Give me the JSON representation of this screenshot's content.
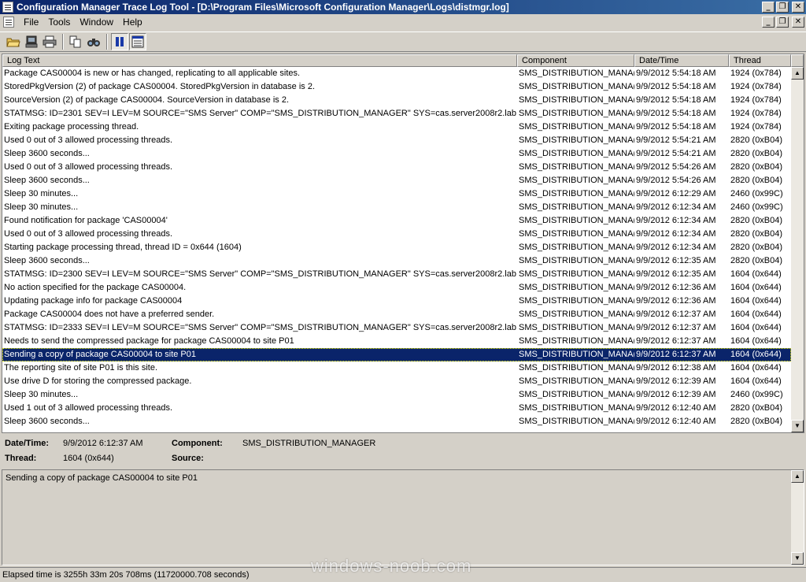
{
  "window": {
    "title": "Configuration Manager Trace Log Tool - [D:\\Program Files\\Microsoft Configuration Manager\\Logs\\distmgr.log]",
    "controls": {
      "minimize": "_",
      "restore": "❐",
      "close": "✕"
    }
  },
  "menu": {
    "items": [
      "File",
      "Tools",
      "Window",
      "Help"
    ]
  },
  "toolbar": {
    "buttons": [
      "open-folder-icon",
      "computer-icon",
      "print-icon",
      "copy-icon",
      "find-icon",
      "pause-icon",
      "details-pane-icon"
    ]
  },
  "log": {
    "columns": [
      "Log Text",
      "Component",
      "Date/Time",
      "Thread"
    ],
    "rows": [
      {
        "text": "Package CAS00004 is new or has changed, replicating to all applicable sites.",
        "component": "SMS_DISTRIBUTION_MANA(",
        "datetime": "9/9/2012 5:54:18 AM",
        "thread": "1924 (0x784)"
      },
      {
        "text": "StoredPkgVersion (2) of package CAS00004. StoredPkgVersion in database is 2.",
        "component": "SMS_DISTRIBUTION_MANA(",
        "datetime": "9/9/2012 5:54:18 AM",
        "thread": "1924 (0x784)"
      },
      {
        "text": "SourceVersion (2) of package CAS00004. SourceVersion in database is 2.",
        "component": "SMS_DISTRIBUTION_MANA(",
        "datetime": "9/9/2012 5:54:18 AM",
        "thread": "1924 (0x784)"
      },
      {
        "text": "STATMSG: ID=2301 SEV=I LEV=M SOURCE=\"SMS Server\" COMP=\"SMS_DISTRIBUTION_MANAGER\" SYS=cas.server2008r2.lab....",
        "component": "SMS_DISTRIBUTION_MANA(",
        "datetime": "9/9/2012 5:54:18 AM",
        "thread": "1924 (0x784)"
      },
      {
        "text": "Exiting package processing thread.",
        "component": "SMS_DISTRIBUTION_MANA(",
        "datetime": "9/9/2012 5:54:18 AM",
        "thread": "1924 (0x784)"
      },
      {
        "text": "Used 0 out of 3 allowed processing threads.",
        "component": "SMS_DISTRIBUTION_MANA(",
        "datetime": "9/9/2012 5:54:21 AM",
        "thread": "2820 (0xB04)"
      },
      {
        "text": "Sleep 3600 seconds...",
        "component": "SMS_DISTRIBUTION_MANA(",
        "datetime": "9/9/2012 5:54:21 AM",
        "thread": "2820 (0xB04)"
      },
      {
        "text": "Used 0 out of 3 allowed processing threads.",
        "component": "SMS_DISTRIBUTION_MANA(",
        "datetime": "9/9/2012 5:54:26 AM",
        "thread": "2820 (0xB04)"
      },
      {
        "text": "Sleep 3600 seconds...",
        "component": "SMS_DISTRIBUTION_MANA(",
        "datetime": "9/9/2012 5:54:26 AM",
        "thread": "2820 (0xB04)"
      },
      {
        "text": "Sleep 30 minutes...",
        "component": "SMS_DISTRIBUTION_MANA(",
        "datetime": "9/9/2012 6:12:29 AM",
        "thread": "2460 (0x99C)"
      },
      {
        "text": "Sleep 30 minutes...",
        "component": "SMS_DISTRIBUTION_MANA(",
        "datetime": "9/9/2012 6:12:34 AM",
        "thread": "2460 (0x99C)"
      },
      {
        "text": "Found notification for package 'CAS00004'",
        "component": "SMS_DISTRIBUTION_MANA(",
        "datetime": "9/9/2012 6:12:34 AM",
        "thread": "2820 (0xB04)"
      },
      {
        "text": "Used 0 out of 3 allowed processing threads.",
        "component": "SMS_DISTRIBUTION_MANA(",
        "datetime": "9/9/2012 6:12:34 AM",
        "thread": "2820 (0xB04)"
      },
      {
        "text": "Starting package processing thread, thread ID = 0x644 (1604)",
        "component": "SMS_DISTRIBUTION_MANA(",
        "datetime": "9/9/2012 6:12:34 AM",
        "thread": "2820 (0xB04)"
      },
      {
        "text": "Sleep 3600 seconds...",
        "component": "SMS_DISTRIBUTION_MANA(",
        "datetime": "9/9/2012 6:12:35 AM",
        "thread": "2820 (0xB04)"
      },
      {
        "text": "STATMSG: ID=2300 SEV=I LEV=M SOURCE=\"SMS Server\" COMP=\"SMS_DISTRIBUTION_MANAGER\" SYS=cas.server2008r2.lab....",
        "component": "SMS_DISTRIBUTION_MANA(",
        "datetime": "9/9/2012 6:12:35 AM",
        "thread": "1604 (0x644)"
      },
      {
        "text": "No action specified for the package CAS00004.",
        "component": "SMS_DISTRIBUTION_MANA(",
        "datetime": "9/9/2012 6:12:36 AM",
        "thread": "1604 (0x644)"
      },
      {
        "text": "Updating package info for package CAS00004",
        "component": "SMS_DISTRIBUTION_MANA(",
        "datetime": "9/9/2012 6:12:36 AM",
        "thread": "1604 (0x644)"
      },
      {
        "text": "Package CAS00004 does not have a preferred sender.",
        "component": "SMS_DISTRIBUTION_MANA(",
        "datetime": "9/9/2012 6:12:37 AM",
        "thread": "1604 (0x644)"
      },
      {
        "text": "STATMSG: ID=2333 SEV=I LEV=M SOURCE=\"SMS Server\" COMP=\"SMS_DISTRIBUTION_MANAGER\" SYS=cas.server2008r2.lab....",
        "component": "SMS_DISTRIBUTION_MANA(",
        "datetime": "9/9/2012 6:12:37 AM",
        "thread": "1604 (0x644)"
      },
      {
        "text": "Needs to send the compressed package for package CAS00004 to site P01",
        "component": "SMS_DISTRIBUTION_MANA(",
        "datetime": "9/9/2012 6:12:37 AM",
        "thread": "1604 (0x644)"
      },
      {
        "text": "Sending a copy of package CAS00004 to site P01",
        "component": "SMS_DISTRIBUTION_MANA(",
        "datetime": "9/9/2012 6:12:37 AM",
        "thread": "1604 (0x644)",
        "selected": true
      },
      {
        "text": "The reporting site of site P01 is this site.",
        "component": "SMS_DISTRIBUTION_MANA(",
        "datetime": "9/9/2012 6:12:38 AM",
        "thread": "1604 (0x644)"
      },
      {
        "text": "Use drive D for storing the compressed package.",
        "component": "SMS_DISTRIBUTION_MANA(",
        "datetime": "9/9/2012 6:12:39 AM",
        "thread": "1604 (0x644)"
      },
      {
        "text": "Sleep 30 minutes...",
        "component": "SMS_DISTRIBUTION_MANA(",
        "datetime": "9/9/2012 6:12:39 AM",
        "thread": "2460 (0x99C)"
      },
      {
        "text": "Used 1 out of 3 allowed processing threads.",
        "component": "SMS_DISTRIBUTION_MANA(",
        "datetime": "9/9/2012 6:12:40 AM",
        "thread": "2820 (0xB04)"
      },
      {
        "text": "Sleep 3600 seconds...",
        "component": "SMS_DISTRIBUTION_MANA(",
        "datetime": "9/9/2012 6:12:40 AM",
        "thread": "2820 (0xB04)"
      }
    ]
  },
  "details": {
    "datetime_label": "Date/Time:",
    "datetime_value": "9/9/2012 6:12:37 AM",
    "component_label": "Component:",
    "component_value": "SMS_DISTRIBUTION_MANAGER",
    "thread_label": "Thread:",
    "thread_value": "1604 (0x644)",
    "source_label": "Source:",
    "source_value": ""
  },
  "message": "Sending a copy of package CAS00004 to site P01",
  "status": "Elapsed time is 3255h 33m 20s 708ms (11720000.708 seconds)",
  "watermark": "windows-noob.com",
  "colors": {
    "title_bar": "#0a246a",
    "selection": "#0a246a",
    "chrome": "#d4d0c8"
  }
}
